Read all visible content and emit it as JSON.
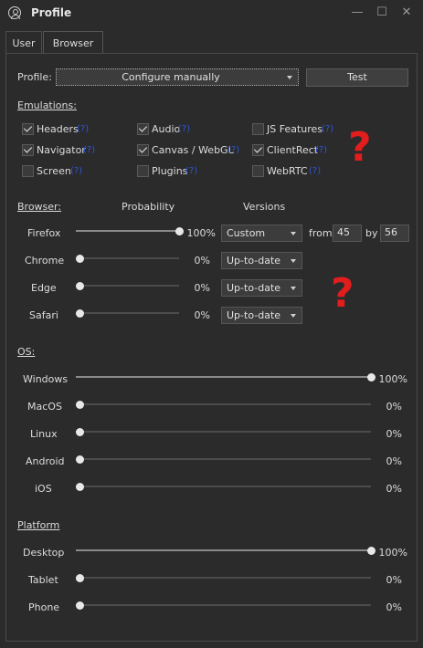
{
  "window": {
    "title": "Profile",
    "minimize": "—",
    "maximize": "☐",
    "close": "✕"
  },
  "tabs": [
    {
      "label": "User",
      "active": false
    },
    {
      "label": "Browser",
      "active": true
    }
  ],
  "profile": {
    "label": "Profile:",
    "value": "Configure manually",
    "test_label": "Test"
  },
  "emulations": {
    "heading": "Emulations:",
    "help": "(?)",
    "items": [
      {
        "label": "Headers",
        "checked": true
      },
      {
        "label": "Audio",
        "checked": true
      },
      {
        "label": "JS Features",
        "checked": false
      },
      {
        "label": "Navigator",
        "checked": true
      },
      {
        "label": "Canvas / WebGL",
        "checked": true
      },
      {
        "label": "ClientRect",
        "checked": true
      },
      {
        "label": "Screen",
        "checked": false
      },
      {
        "label": "Plugins",
        "checked": false
      },
      {
        "label": "WebRTC",
        "checked": false
      }
    ]
  },
  "browser": {
    "heading": "Browser:",
    "col_probability": "Probability",
    "col_versions": "Versions",
    "rows": [
      {
        "name": "Firefox",
        "value": 100,
        "pct": "100%",
        "version": "Custom",
        "from_label": "from",
        "from": "45",
        "by_label": "by",
        "by": "56"
      },
      {
        "name": "Chrome",
        "value": 0,
        "pct": "0%",
        "version": "Up-to-date"
      },
      {
        "name": "Edge",
        "value": 0,
        "pct": "0%",
        "version": "Up-to-date"
      },
      {
        "name": "Safari",
        "value": 0,
        "pct": "0%",
        "version": "Up-to-date"
      }
    ]
  },
  "os": {
    "heading": "OS:",
    "rows": [
      {
        "name": "Windows",
        "value": 100,
        "pct": "100%"
      },
      {
        "name": "MacOS",
        "value": 0,
        "pct": "0%"
      },
      {
        "name": "Linux",
        "value": 0,
        "pct": "0%"
      },
      {
        "name": "Android",
        "value": 0,
        "pct": "0%"
      },
      {
        "name": "iOS",
        "value": 0,
        "pct": "0%"
      }
    ]
  },
  "platform": {
    "heading": "Platform",
    "rows": [
      {
        "name": "Desktop",
        "value": 100,
        "pct": "100%"
      },
      {
        "name": "Tablet",
        "value": 0,
        "pct": "0%"
      },
      {
        "name": "Phone",
        "value": 0,
        "pct": "0%"
      }
    ]
  },
  "annotations": {
    "mark1": "?",
    "mark2": "?"
  },
  "colors": {
    "background": "#2b2b2b",
    "help_link": "#2f55d6",
    "annotation": "#e11d1d"
  }
}
